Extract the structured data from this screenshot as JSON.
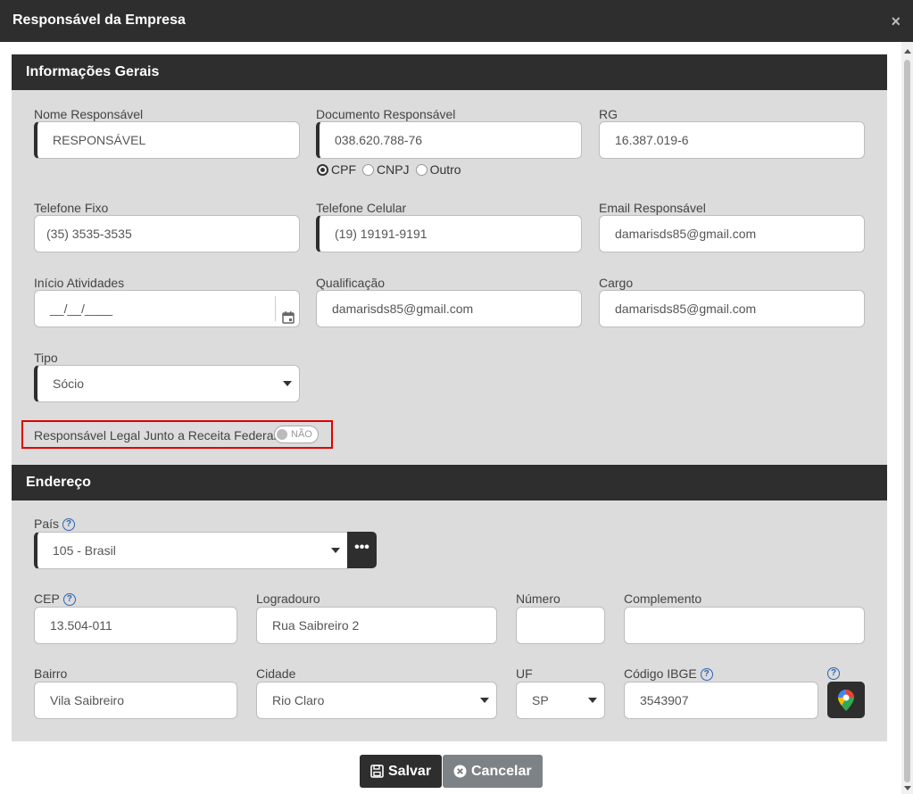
{
  "window": {
    "title": "Responsável da Empresa",
    "close": "×"
  },
  "general": {
    "header": "Informações Gerais",
    "nome_label": "Nome Responsável",
    "nome_placeholder": "RESPONSÁVEL",
    "documento_label": "Documento Responsável",
    "documento_value": "038.620.788-76",
    "doc_types": [
      "CPF",
      "CNPJ",
      "Outro"
    ],
    "doc_type_selected": "CPF",
    "rg_label": "RG",
    "rg_value": "16.387.019-6",
    "telefone_fixo_label": "Telefone Fixo",
    "telefone_fixo_value": "(35) 3535-3535",
    "telefone_celular_label": "Telefone Celular",
    "telefone_celular_value": "(19) 19191-9191",
    "email_label": "Email Responsável",
    "email_value": "damarisds85@gmail.com",
    "inicio_label": "Início Atividades",
    "inicio_value": "__/__/____",
    "qualificacao_label": "Qualificação",
    "qualificacao_value": "damarisds85@gmail.com",
    "cargo_label": "Cargo",
    "cargo_value": "damarisds85@gmail.com",
    "tipo_label": "Tipo",
    "tipo_value": "Sócio",
    "legal_label": "Responsável Legal Junto a Receita Federal",
    "legal_toggle": "NÃO"
  },
  "address": {
    "header": "Endereço",
    "pais_label": "País",
    "pais_value": "105 - Brasil",
    "pais_more": "•••",
    "cep_label": "CEP",
    "cep_value": "13.504-011",
    "logradouro_label": "Logradouro",
    "logradouro_value": "Rua Saibreiro 2",
    "numero_label": "Número",
    "numero_value": "",
    "complemento_label": "Complemento",
    "complemento_value": "",
    "bairro_label": "Bairro",
    "bairro_value": "Vila Saibreiro",
    "cidade_label": "Cidade",
    "cidade_value": "Rio Claro",
    "uf_label": "UF",
    "uf_value": "SP",
    "ibge_label": "Código IBGE",
    "ibge_value": "3543907",
    "help": "?"
  },
  "footer": {
    "save_label": "Salvar",
    "cancel_label": "Cancelar"
  },
  "colors": {
    "dark": "#2e2e2e",
    "panel": "#dcdcdc",
    "highlight": "#e00000",
    "help": "#2d63b0"
  }
}
